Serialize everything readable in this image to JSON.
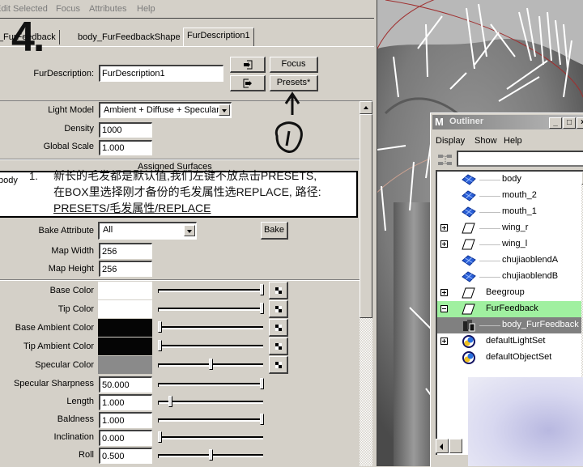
{
  "attribute_editor": {
    "menus": [
      "Edit",
      "Selected",
      "Focus",
      "Attributes",
      "Help"
    ],
    "tabs": [
      "body_FurFeedback",
      "body_FurFeedbackShape",
      "FurDescription1"
    ],
    "active_tab": "FurDescription1",
    "overlay_step_number": "4.",
    "node_label": "FurDescription:",
    "node_name": "FurDescription1",
    "focus_button": "Focus",
    "presets_button": "Presets*",
    "light_model": {
      "label": "Light Model",
      "value": "Ambient + Diffuse + Specular"
    },
    "density": {
      "label": "Density",
      "value": "1000"
    },
    "global_scale": {
      "label": "Global Scale",
      "value": "1.000"
    },
    "assigned_surfaces": {
      "title": "Assigned Surfaces",
      "items": [
        "body"
      ]
    },
    "bake_attribute": {
      "label": "Bake Attribute",
      "value": "All",
      "button": "Bake"
    },
    "map_width": {
      "label": "Map Width",
      "value": "256"
    },
    "map_height": {
      "label": "Map Height",
      "value": "256"
    },
    "color_attributes": [
      {
        "label": "Base Color",
        "color": "#ffffff",
        "slider": 1.0
      },
      {
        "label": "Tip Color",
        "color": "#ffffff",
        "slider": 1.0
      },
      {
        "label": "Base Ambient Color",
        "color": "#050505",
        "slider": 0.0
      },
      {
        "label": "Tip Ambient Color",
        "color": "#050505",
        "slider": 0.0
      },
      {
        "label": "Specular Color",
        "color": "#8a8a8a",
        "slider": 0.5
      }
    ],
    "numeric_attributes": [
      {
        "label": "Specular Sharpness",
        "value": "50.000",
        "slider": 1.0
      },
      {
        "label": "Length",
        "value": "1.000",
        "slider": 0.1
      },
      {
        "label": "Baldness",
        "value": "1.000",
        "slider": 1.0
      },
      {
        "label": "Inclination",
        "value": "0.000",
        "slider": 0.0
      },
      {
        "label": "Roll",
        "value": "0.500",
        "slider": 0.5
      }
    ]
  },
  "annotation": {
    "number": "1.",
    "lines": [
      "新长的毛发都是默认值,我们左键不放点击PRESETS,",
      "在BOX里选择刚才备份的毛发属性选REPLACE, 路径:",
      "PRESETS/毛发属性/REPLACE"
    ],
    "circled_marker": "1"
  },
  "outliner": {
    "title": "Outliner",
    "menus": [
      "Display",
      "Show",
      "Help"
    ],
    "search_value": "",
    "items": [
      {
        "name": "body",
        "icon": "mesh",
        "expand": "",
        "state": ""
      },
      {
        "name": "mouth_2",
        "icon": "mesh",
        "expand": "",
        "state": ""
      },
      {
        "name": "mouth_1",
        "icon": "mesh",
        "expand": "",
        "state": ""
      },
      {
        "name": "wing_r",
        "icon": "transform",
        "expand": "+",
        "state": ""
      },
      {
        "name": "wing_l",
        "icon": "transform",
        "expand": "+",
        "state": ""
      },
      {
        "name": "chujiaoblendA",
        "icon": "mesh",
        "expand": "",
        "state": ""
      },
      {
        "name": "chujiaoblendB",
        "icon": "mesh",
        "expand": "",
        "state": ""
      },
      {
        "name": "Beegroup",
        "icon": "transform",
        "expand": "+",
        "state": ""
      },
      {
        "name": "FurFeedback",
        "icon": "transform",
        "expand": "-",
        "state": "selected-parent"
      },
      {
        "name": "body_FurFeedback",
        "icon": "fur",
        "expand": "",
        "state": "selected"
      },
      {
        "name": "defaultLightSet",
        "icon": "set",
        "expand": "+",
        "state": ""
      },
      {
        "name": "defaultObjectSet",
        "icon": "set",
        "expand": "",
        "state": ""
      }
    ],
    "colors": {
      "selected_parent": "#a0f0a0",
      "selected": "#808080",
      "mesh_icon": "#2050d0"
    }
  }
}
